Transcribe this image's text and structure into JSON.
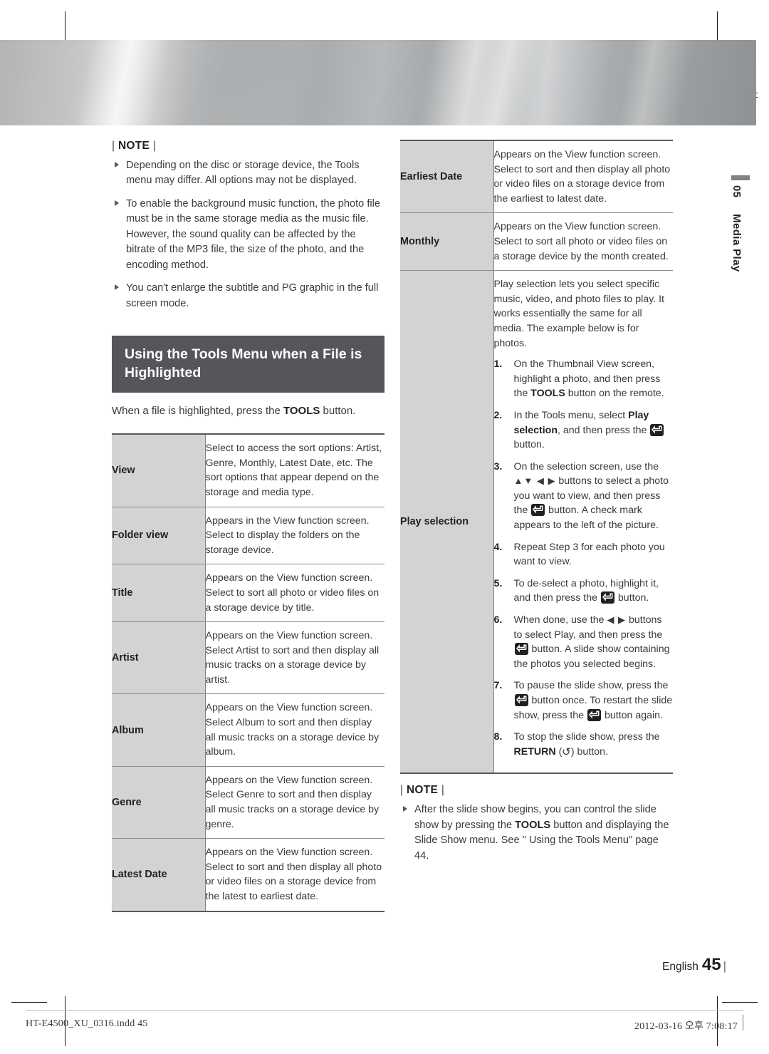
{
  "page": {
    "chapter_number": "05",
    "chapter_title": "Media Play",
    "language": "English",
    "page_number": "45",
    "footer_file": "HT-E4500_XU_0316.indd   45",
    "footer_date": "2012-03-16   오후 7:08:17"
  },
  "left_note": {
    "title_left": "|",
    "title": "NOTE",
    "title_right": "|",
    "items": [
      "Depending on the disc or storage device, the Tools menu may differ. All options may not be displayed.",
      "To enable the background music function, the photo file must be in the same storage media as the music file. However, the sound quality can be affected by the bitrate of the MP3 file, the size of the photo, and the encoding method.",
      "You can't enlarge the subtitle and PG graphic in the full screen mode."
    ]
  },
  "section": {
    "heading": "Using the Tools Menu when a File is Highlighted",
    "intro_before": "When a file is highlighted, press the ",
    "intro_bold": "TOOLS",
    "intro_after": " button."
  },
  "left_table": {
    "rows": [
      {
        "key": "View",
        "value": "Select to access the sort options: Artist, Genre, Monthly, Latest Date, etc. The sort options that appear depend on the storage and media type."
      },
      {
        "key": "Folder view",
        "value": "Appears in the View function screen. Select to display the folders on the storage device."
      },
      {
        "key": "Title",
        "value": "Appears on the View function screen. Select to sort all photo or video files on a storage device by title."
      },
      {
        "key": "Artist",
        "value": "Appears on the View function screen. Select Artist to sort and then display all music tracks on a storage device by artist."
      },
      {
        "key": "Album",
        "value": "Appears on the View function screen. Select Album to sort and then display all music tracks on a storage device by album."
      },
      {
        "key": "Genre",
        "value": "Appears on the View function screen. Select Genre to sort and then display all music tracks on a storage device by genre."
      },
      {
        "key": "Latest Date",
        "value": "Appears on the View function screen. Select to sort and then display all photo or video files on a storage device from the latest to earliest date."
      }
    ]
  },
  "right_table": {
    "rows": [
      {
        "key": "Earliest Date",
        "value": "Appears on the View function screen. Select to sort and then display all photo or video files on a storage device from the earliest to latest date."
      },
      {
        "key": "Monthly",
        "value": "Appears on the View function screen. Select to sort all photo or video files on a storage device by the month created."
      }
    ],
    "play_selection": {
      "key": "Play selection",
      "intro": "Play selection lets you select specific music, video, and photo files to play. It works essentially the same for all media. The example below is for photos.",
      "steps": [
        {
          "num": "1.",
          "parts": [
            {
              "t": "text",
              "v": "On the Thumbnail View screen, highlight a photo, and then press the "
            },
            {
              "t": "bold",
              "v": "TOOLS"
            },
            {
              "t": "text",
              "v": " button on the remote."
            }
          ]
        },
        {
          "num": "2.",
          "parts": [
            {
              "t": "text",
              "v": "In the Tools menu, select "
            },
            {
              "t": "bold",
              "v": "Play selection"
            },
            {
              "t": "text",
              "v": ", and then press the "
            },
            {
              "t": "icon",
              "v": "enter-icon"
            },
            {
              "t": "text",
              "v": " button."
            }
          ]
        },
        {
          "num": "3.",
          "parts": [
            {
              "t": "text",
              "v": "On the selection screen, use the "
            },
            {
              "t": "arrows",
              "v": "▲▼ ◀ ▶"
            },
            {
              "t": "text",
              "v": " buttons to select a photo you want to view, and then press the "
            },
            {
              "t": "icon",
              "v": "enter-icon"
            },
            {
              "t": "text",
              "v": " button. A check mark appears to the left of the picture."
            }
          ]
        },
        {
          "num": "4.",
          "parts": [
            {
              "t": "text",
              "v": "Repeat Step 3 for each photo you want to view."
            }
          ]
        },
        {
          "num": "5.",
          "parts": [
            {
              "t": "text",
              "v": "To de-select a photo, highlight it, and then press the "
            },
            {
              "t": "icon",
              "v": "enter-icon"
            },
            {
              "t": "text",
              "v": " button."
            }
          ]
        },
        {
          "num": "6.",
          "parts": [
            {
              "t": "text",
              "v": "When done, use the "
            },
            {
              "t": "arrows",
              "v": "◀ ▶"
            },
            {
              "t": "text",
              "v": " buttons to select Play, and then press the "
            },
            {
              "t": "icon",
              "v": "enter-icon"
            },
            {
              "t": "text",
              "v": " button. A slide show containing the photos you selected begins."
            }
          ]
        },
        {
          "num": "7.",
          "parts": [
            {
              "t": "text",
              "v": "To pause the slide show, press the "
            },
            {
              "t": "icon",
              "v": "enter-icon"
            },
            {
              "t": "text",
              "v": " button once. To restart the slide show, press the "
            },
            {
              "t": "icon",
              "v": "enter-icon"
            },
            {
              "t": "text",
              "v": " button again."
            }
          ]
        },
        {
          "num": "8.",
          "parts": [
            {
              "t": "text",
              "v": "To stop the slide show, press the "
            },
            {
              "t": "bold",
              "v": "RETURN"
            },
            {
              "t": "text",
              "v": " ("
            },
            {
              "t": "return",
              "v": "return-arrow-icon"
            },
            {
              "t": "text",
              "v": ") button."
            }
          ]
        }
      ]
    }
  },
  "right_note": {
    "title": "NOTE",
    "item_parts": [
      {
        "t": "text",
        "v": "After the slide show begins, you can control the slide show by pressing the "
      },
      {
        "t": "bold",
        "v": "TOOLS"
      },
      {
        "t": "text",
        "v": " button and displaying the Slide Show menu. See \" Using the Tools Menu\" page 44."
      }
    ]
  },
  "colors": {
    "heading_bar": "#55565a",
    "table_key_bg": "#d2d3d5",
    "rule": "#58595b",
    "text": "#231f20"
  }
}
